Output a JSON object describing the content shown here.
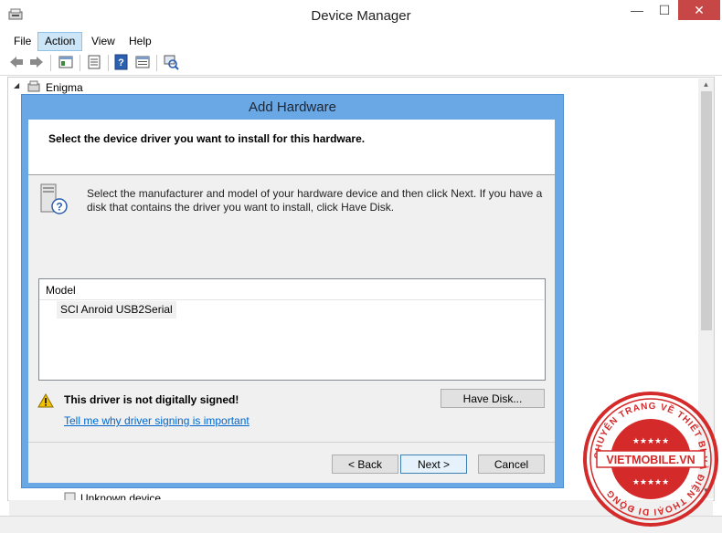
{
  "window": {
    "title": "Device Manager",
    "minimize": "—",
    "maximize": "☐",
    "close": "✕"
  },
  "menu": {
    "file": "File",
    "action": "Action",
    "view": "View",
    "help": "Help"
  },
  "tree": {
    "root_label": "Enigma",
    "root_expander": "◢",
    "bottom_item": "Unknown device"
  },
  "dialog": {
    "title": "Add Hardware",
    "header": "Select the device driver you want to install for this hardware.",
    "description": "Select the manufacturer and model of your hardware device and then click Next. If you have a disk that contains the driver you want to install, click Have Disk.",
    "model_header": "Model",
    "models": [
      "SCI Anroid USB2Serial"
    ],
    "warning": "This driver is not digitally signed!",
    "link": "Tell me why driver signing is important",
    "have_disk": "Have Disk...",
    "back": "< Back",
    "next": "Next >",
    "cancel": "Cancel"
  },
  "stamp": {
    "brand": "VIETMOBILE.VN",
    "ring_text": "CHUYÊN TRANG VỀ THIẾT BỊ VÀ ĐIỆN THOẠI DI ĐỘNG"
  },
  "colors": {
    "dialog_frame": "#6aa7e5",
    "close_button": "#c74646",
    "link": "#0066cc",
    "stamp_red": "#d42a2a"
  }
}
